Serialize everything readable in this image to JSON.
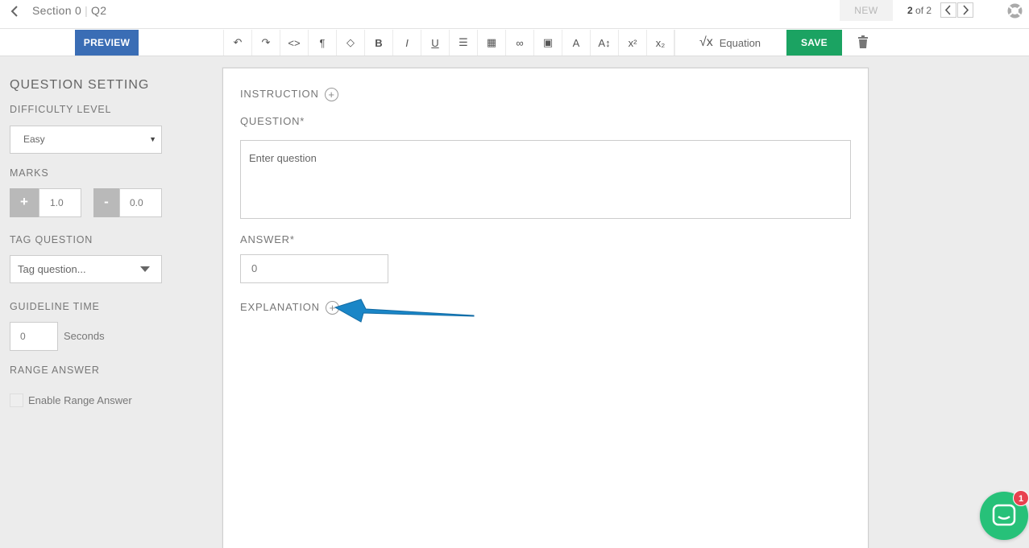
{
  "header": {
    "section": "Section 0",
    "separator": "|",
    "question_id": "Q2",
    "new_label": "NEW",
    "pager_current": "2",
    "pager_rest": "of 2"
  },
  "toolbar": {
    "preview_label": "PREVIEW",
    "tools": [
      {
        "name": "undo-icon",
        "glyph": "↶"
      },
      {
        "name": "redo-icon",
        "glyph": "↷"
      },
      {
        "name": "code-icon",
        "glyph": "<>"
      },
      {
        "name": "paragraph-icon",
        "glyph": "¶"
      },
      {
        "name": "color-drop-icon",
        "glyph": "◇"
      },
      {
        "name": "bold-icon",
        "glyph": "B"
      },
      {
        "name": "italic-icon",
        "glyph": "I"
      },
      {
        "name": "underline-icon",
        "glyph": "U"
      },
      {
        "name": "list-icon",
        "glyph": "☰"
      },
      {
        "name": "table-icon",
        "glyph": "▦"
      },
      {
        "name": "link-icon",
        "glyph": "∞"
      },
      {
        "name": "image-icon",
        "glyph": "▣"
      },
      {
        "name": "text-style-icon",
        "glyph": "A"
      },
      {
        "name": "font-size-icon",
        "glyph": "A↕"
      },
      {
        "name": "superscript-icon",
        "glyph": "x²"
      },
      {
        "name": "subscript-icon",
        "glyph": "x₂"
      }
    ],
    "equation_symbol": "√x",
    "equation_label": "Equation",
    "save_label": "SAVE"
  },
  "sidebar": {
    "title": "QUESTION SETTING",
    "difficulty_label": "DIFFICULTY LEVEL",
    "difficulty_value": "Easy",
    "marks_label": "MARKS",
    "marks_plus_symbol": "+",
    "marks_plus_value": "1.0",
    "marks_minus_symbol": "-",
    "marks_minus_value": "0.0",
    "tag_label": "TAG QUESTION",
    "tag_placeholder": "Tag question...",
    "guideline_label": "GUIDELINE TIME",
    "guideline_value": "0",
    "guideline_unit": "Seconds",
    "range_label": "RANGE ANSWER",
    "range_checkbox_label": "Enable Range Answer"
  },
  "editor": {
    "instruction_label": "INSTRUCTION",
    "question_label": "QUESTION*",
    "question_placeholder": "Enter question",
    "answer_label": "ANSWER*",
    "answer_value": "0",
    "explanation_label": "EXPLANATION",
    "add_symbol": "+"
  },
  "chat": {
    "badge_count": "1"
  },
  "colors": {
    "preview_blue": "#3a6db5",
    "save_green": "#1ba362",
    "arrow_blue": "#1a86c7",
    "chat_green": "#27c179",
    "badge_red": "#e8414f"
  }
}
